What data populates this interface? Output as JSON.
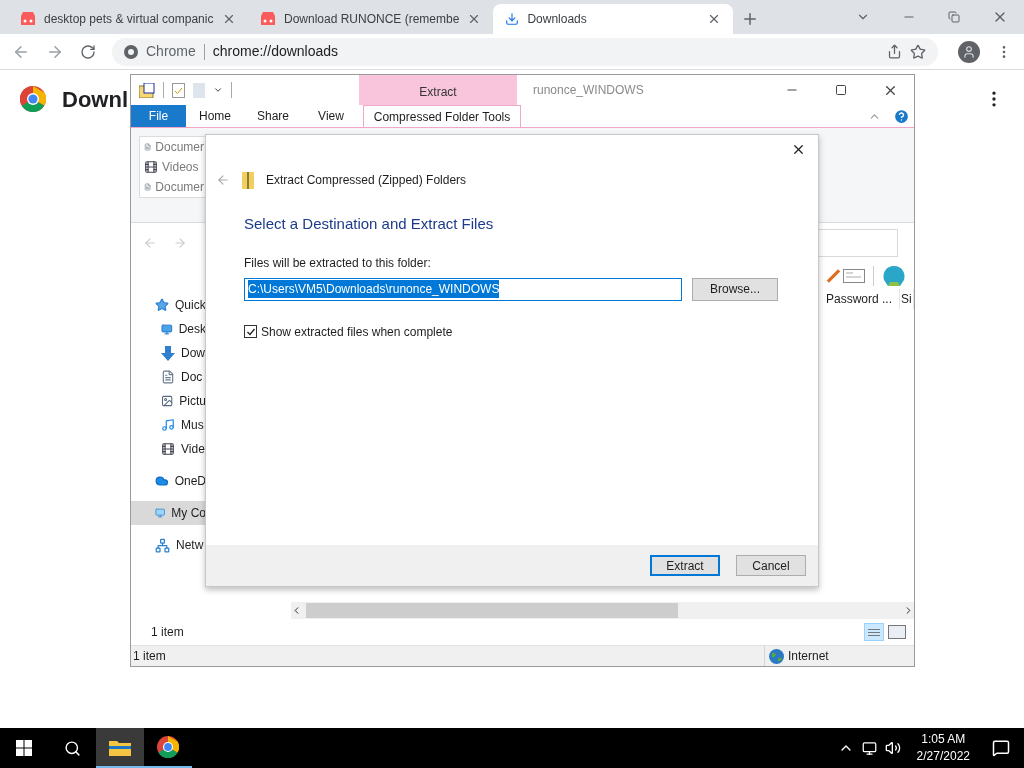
{
  "browser": {
    "tabs": [
      {
        "title": "desktop pets & virtual companic",
        "kind": "game",
        "selected": false
      },
      {
        "title": "Download RUNONCE (remembe",
        "kind": "game",
        "selected": false
      },
      {
        "title": "Downloads",
        "kind": "download",
        "selected": true
      }
    ],
    "omnibox": {
      "chip": "Chrome",
      "url": "chrome://downloads"
    },
    "page_title": "Downl"
  },
  "explorer": {
    "context_tab": "Extract",
    "title": "runonce_WINDOWS",
    "ribbon_tabs": [
      {
        "label": "File",
        "kind": "file",
        "selected": false
      },
      {
        "label": "Home",
        "kind": "tab",
        "selected": false
      },
      {
        "label": "Share",
        "kind": "tab",
        "selected": false
      },
      {
        "label": "View",
        "kind": "tab",
        "selected": false
      },
      {
        "label": "Compressed Folder Tools",
        "kind": "context",
        "selected": true
      }
    ],
    "recent_items": [
      {
        "label": "Documer",
        "kind": "doc"
      },
      {
        "label": "Videos",
        "kind": "video"
      },
      {
        "label": "Documer",
        "kind": "doc"
      }
    ],
    "nav_items": [
      {
        "label": "Quick",
        "kind": "star",
        "selected": false,
        "group": true
      },
      {
        "label": "Desk",
        "kind": "desktop",
        "selected": false,
        "group": false
      },
      {
        "label": "Dow",
        "kind": "download",
        "selected": false,
        "group": false
      },
      {
        "label": "Doc",
        "kind": "doc",
        "selected": false,
        "group": false
      },
      {
        "label": "Pictu",
        "kind": "picture",
        "selected": false,
        "group": false
      },
      {
        "label": "Mus",
        "kind": "music",
        "selected": false,
        "group": false
      },
      {
        "label": "Vide",
        "kind": "video",
        "selected": false,
        "group": false
      },
      {
        "label": "OneD",
        "kind": "cloud",
        "selected": false,
        "group": true
      },
      {
        "label": "My Co",
        "kind": "pc",
        "selected": true,
        "group": true
      },
      {
        "label": "Netw",
        "kind": "network",
        "selected": false,
        "group": true
      }
    ],
    "column_headers": [
      "Password ...",
      "Si"
    ],
    "item_count": "1 item",
    "status_bar": {
      "items": "1 item",
      "zone": "Internet"
    }
  },
  "dialog": {
    "title": "Extract Compressed (Zipped) Folders",
    "heading": "Select a Destination and Extract Files",
    "field_label": "Files will be extracted to this folder:",
    "path": "C:\\Users\\VM5\\Downloads\\runonce_WINDOWS",
    "browse": "Browse...",
    "checkbox": {
      "label": "Show extracted files when complete",
      "checked": true
    },
    "buttons": [
      {
        "label": "Extract",
        "default": true
      },
      {
        "label": "Cancel",
        "default": false
      }
    ]
  },
  "taskbar": {
    "time": "1:05 AM",
    "date": "2/27/2022"
  }
}
